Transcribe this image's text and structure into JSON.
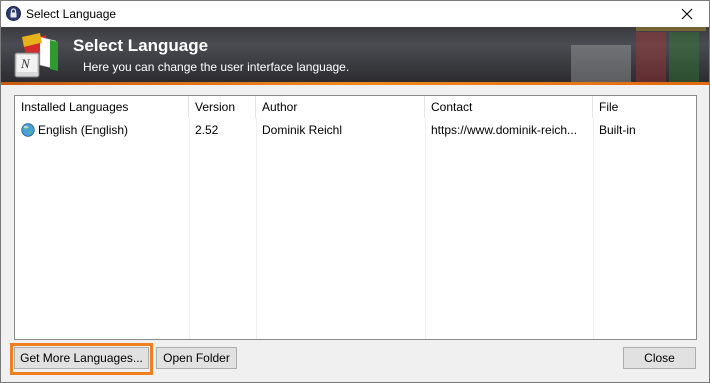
{
  "window": {
    "title": "Select Language",
    "close_glyph": "✕"
  },
  "banner": {
    "title": "Select Language",
    "subtitle": "Here you can change the user interface language.",
    "logo_letter": "N"
  },
  "list": {
    "columns": [
      "Installed Languages",
      "Version",
      "Author",
      "Contact",
      "File"
    ],
    "rows": [
      {
        "language": "English (English)",
        "version": "2.52",
        "author": "Dominik Reichl",
        "contact": "https://www.dominik-reich...",
        "file": "Built-in"
      }
    ]
  },
  "buttons": {
    "get_more": "Get More Languages...",
    "open_folder": "Open Folder",
    "close": "Close"
  },
  "colors": {
    "highlight": "#f07f1f",
    "banner_dark": "#3c3d42"
  },
  "icons": [
    "keepass-lock-icon",
    "close-icon",
    "language-flags-logo",
    "globe-icon"
  ]
}
